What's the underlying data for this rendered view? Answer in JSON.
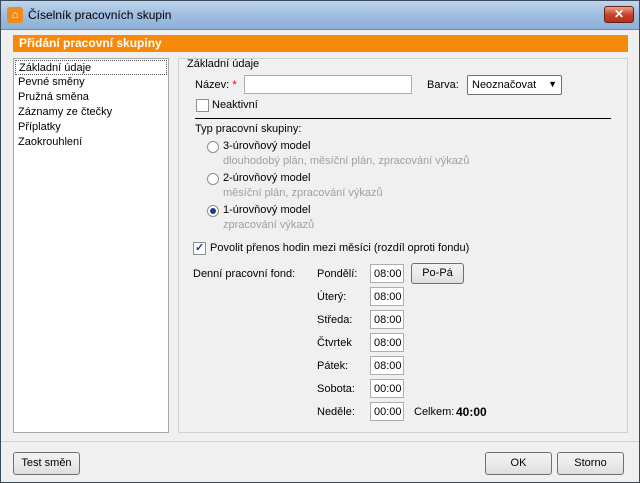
{
  "window": {
    "title": "Číselník pracovních skupin",
    "close_glyph": "✕"
  },
  "header": {
    "title": "Přidání pracovní skupiny"
  },
  "nav": {
    "items": [
      "Základní údaje",
      "Pevné směny",
      "Pružná směna",
      "Záznamy ze čtečky",
      "Příplatky",
      "Zaokrouhlení"
    ],
    "selected": "Základní údaje"
  },
  "form": {
    "section_title": "Základní údaje",
    "name_label": "Název:",
    "required_mark": "*",
    "name_value": "",
    "color_label": "Barva:",
    "color_value": "Neoznačovat",
    "inactive_label": "Neaktivní",
    "inactive_checked": false,
    "type_label": "Typ pracovní skupiny:",
    "types": [
      {
        "label": "3-úrovňový model",
        "desc": "dlouhodobý plán, měsíční plán, zpracování výkazů",
        "selected": false
      },
      {
        "label": "2-úrovňový model",
        "desc": "měsíční plán, zpracování výkazů",
        "selected": false
      },
      {
        "label": "1-úrovňový model",
        "desc": "zpracování výkazů",
        "selected": true
      }
    ],
    "transfer_label": "Povolit přenos hodin mezi měsíci (rozdíl oproti fondu)",
    "transfer_checked": true,
    "fund_label": "Denní pracovní fond:",
    "days": [
      {
        "label": "Pondělí:",
        "value": "08:00"
      },
      {
        "label": "Úterý:",
        "value": "08:00"
      },
      {
        "label": "Středa:",
        "value": "08:00"
      },
      {
        "label": "Čtvrtek",
        "value": "08:00"
      },
      {
        "label": "Pátek:",
        "value": "08:00"
      },
      {
        "label": "Sobota:",
        "value": "00:00"
      },
      {
        "label": "Neděle:",
        "value": "00:00"
      }
    ],
    "po_pa_button": "Po-Pá",
    "total_label": "Celkem:",
    "total_value": "40:00"
  },
  "footer": {
    "test_button": "Test směn",
    "ok_button": "OK",
    "cancel_button": "Storno"
  },
  "colors": {
    "accent": "#f7890b",
    "titlebar": "#9fbde0"
  }
}
